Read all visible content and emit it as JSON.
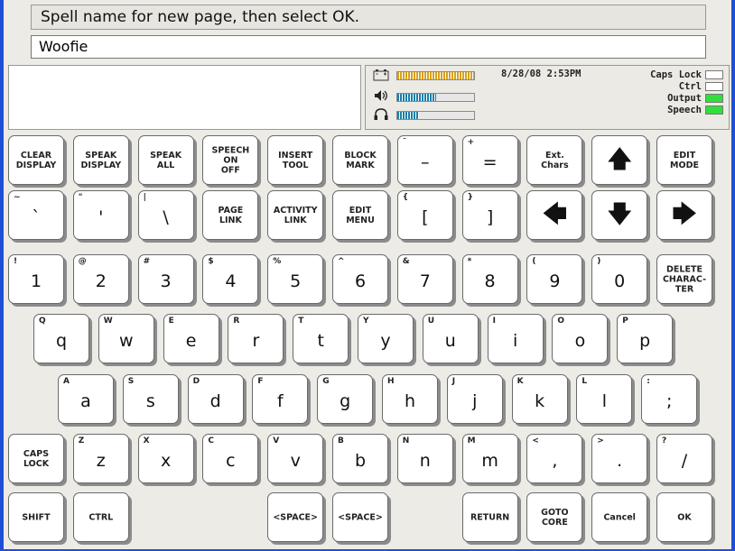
{
  "prompt": "Spell name for new page, then select OK.",
  "name_value": "Woofie",
  "status": {
    "datetime": "8/28/08 2:53PM",
    "meters": [
      {
        "icon": "battery-icon",
        "level": 1.0,
        "color": "#d8a21a"
      },
      {
        "icon": "speaker-icon",
        "level": 0.5,
        "color": "#1a7fa8"
      },
      {
        "icon": "headphones-icon",
        "level": 0.28,
        "color": "#1a7fa8"
      }
    ],
    "indicators": [
      {
        "label": "Caps Lock",
        "on": false
      },
      {
        "label": "Ctrl",
        "on": false
      },
      {
        "label": "Output",
        "on": true
      },
      {
        "label": "Speech",
        "on": true
      }
    ]
  },
  "keyboard": {
    "rows": [
      [
        {
          "name": "clear-display-key",
          "label": "CLEAR\nDISPLAY"
        },
        {
          "name": "speak-display-key",
          "label": "SPEAK\nDISPLAY"
        },
        {
          "name": "speak-all-key",
          "label": "SPEAK\nALL"
        },
        {
          "name": "speech-on-off-key",
          "label": "SPEECH\nON\nOFF"
        },
        {
          "name": "insert-tool-key",
          "label": "INSERT\nTOOL"
        },
        {
          "name": "block-mark-key",
          "label": "BLOCK\nMARK"
        },
        {
          "name": "minus-key",
          "secondary": "¯",
          "main": "–"
        },
        {
          "name": "equals-key",
          "secondary": "+",
          "main": "="
        },
        {
          "name": "ext-chars-key",
          "label": "Ext.\nChars"
        },
        {
          "name": "up-arrow-key",
          "arrow": "🡅"
        },
        {
          "name": "edit-mode-key",
          "label": "EDIT\nMODE"
        }
      ],
      [
        {
          "name": "grave-key",
          "secondary": "~",
          "main": "`"
        },
        {
          "name": "quote-key",
          "secondary": "\"",
          "main": "'"
        },
        {
          "name": "backslash-key",
          "secondary": "|",
          "main": "\\"
        },
        {
          "name": "page-link-key",
          "label": "PAGE\nLINK"
        },
        {
          "name": "activity-link-key",
          "label": "ACTIVITY\nLINK"
        },
        {
          "name": "edit-menu-key",
          "label": "EDIT\nMENU"
        },
        {
          "name": "left-bracket-key",
          "secondary": "{",
          "main": "["
        },
        {
          "name": "right-bracket-key",
          "secondary": "}",
          "main": "]"
        },
        {
          "name": "left-arrow-key",
          "arrow": "🡄"
        },
        {
          "name": "down-arrow-key",
          "arrow": "🡇"
        },
        {
          "name": "right-arrow-key",
          "arrow": "🡆"
        }
      ],
      [
        {
          "name": "key-1",
          "secondary": "!",
          "main": "1"
        },
        {
          "name": "key-2",
          "secondary": "@",
          "main": "2"
        },
        {
          "name": "key-3",
          "secondary": "#",
          "main": "3"
        },
        {
          "name": "key-4",
          "secondary": "$",
          "main": "4"
        },
        {
          "name": "key-5",
          "secondary": "%",
          "main": "5"
        },
        {
          "name": "key-6",
          "secondary": "^",
          "main": "6"
        },
        {
          "name": "key-7",
          "secondary": "&",
          "main": "7"
        },
        {
          "name": "key-8",
          "secondary": "*",
          "main": "8"
        },
        {
          "name": "key-9",
          "secondary": "(",
          "main": "9"
        },
        {
          "name": "key-0",
          "secondary": ")",
          "main": "0"
        },
        {
          "name": "delete-character-key",
          "label": "DELETE\nCHARAC-\nTER"
        }
      ],
      [
        {
          "name": "key-q",
          "secondary": "Q",
          "main": "q"
        },
        {
          "name": "key-w",
          "secondary": "W",
          "main": "w"
        },
        {
          "name": "key-e",
          "secondary": "E",
          "main": "e"
        },
        {
          "name": "key-r",
          "secondary": "R",
          "main": "r"
        },
        {
          "name": "key-t",
          "secondary": "T",
          "main": "t"
        },
        {
          "name": "key-y",
          "secondary": "Y",
          "main": "y"
        },
        {
          "name": "key-u",
          "secondary": "U",
          "main": "u"
        },
        {
          "name": "key-i",
          "secondary": "I",
          "main": "i"
        },
        {
          "name": "key-o",
          "secondary": "O",
          "main": "o"
        },
        {
          "name": "key-p",
          "secondary": "P",
          "main": "p"
        }
      ],
      [
        {
          "name": "key-a",
          "secondary": "A",
          "main": "a"
        },
        {
          "name": "key-s",
          "secondary": "S",
          "main": "s"
        },
        {
          "name": "key-d",
          "secondary": "D",
          "main": "d"
        },
        {
          "name": "key-f",
          "secondary": "F",
          "main": "f"
        },
        {
          "name": "key-g",
          "secondary": "G",
          "main": "g"
        },
        {
          "name": "key-h",
          "secondary": "H",
          "main": "h"
        },
        {
          "name": "key-j",
          "secondary": "J",
          "main": "j"
        },
        {
          "name": "key-k",
          "secondary": "K",
          "main": "k"
        },
        {
          "name": "key-l",
          "secondary": "L",
          "main": "l"
        },
        {
          "name": "semicolon-key",
          "secondary": ":",
          "main": ";"
        }
      ],
      [
        {
          "name": "caps-lock-key",
          "label": "CAPS\nLOCK"
        },
        {
          "name": "key-z",
          "secondary": "Z",
          "main": "z"
        },
        {
          "name": "key-x",
          "secondary": "X",
          "main": "x"
        },
        {
          "name": "key-c",
          "secondary": "C",
          "main": "c"
        },
        {
          "name": "key-v",
          "secondary": "V",
          "main": "v"
        },
        {
          "name": "key-b",
          "secondary": "B",
          "main": "b"
        },
        {
          "name": "key-n",
          "secondary": "N",
          "main": "n"
        },
        {
          "name": "key-m",
          "secondary": "M",
          "main": "m"
        },
        {
          "name": "comma-key",
          "secondary": "<",
          "main": ","
        },
        {
          "name": "period-key",
          "secondary": ">",
          "main": "."
        },
        {
          "name": "slash-key",
          "secondary": "?",
          "main": "/"
        }
      ],
      [
        {
          "name": "shift-key",
          "label": "SHIFT"
        },
        {
          "name": "ctrl-key",
          "label": "CTRL"
        },
        {
          "name": "space-key-1",
          "label": "<SPACE>"
        },
        {
          "name": "space-key-2",
          "label": "<SPACE>"
        },
        {
          "name": "return-key",
          "label": "RETURN"
        },
        {
          "name": "goto-core-key",
          "label": "GOTO\nCORE"
        },
        {
          "name": "cancel-key",
          "label": "Cancel"
        },
        {
          "name": "ok-key",
          "label": "OK"
        }
      ]
    ]
  }
}
